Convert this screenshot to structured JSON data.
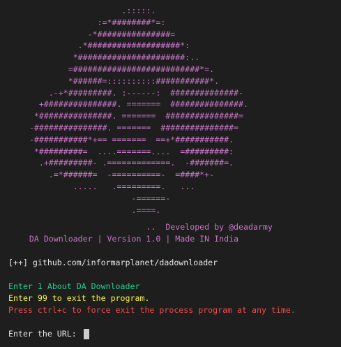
{
  "terminal": {
    "ascii_art_lines": [
      "                         .:::::.",
      "                    :=*########*=:",
      "                  -*###############=",
      "                .*###################*:",
      "               *######################:..",
      "              =##########################*=.",
      "              *######=::::::::::###########*.",
      "          .-+*#########. :------:  ##############-",
      "        +###############. =======  ###############.",
      "       *###############. =======  ###############=",
      "      -###############. =======  ###############=",
      "      -###########*+== =======  ==+*###########.",
      "       *#########=  ....=======....  =#########:",
      "        .+#########- .=============.  -#######=.",
      "          .=*######=  -==========-  =####*+-",
      "               .....   .=========.   ...",
      "                           -======-",
      "                           .====."
    ],
    "credit_text": "                              ..  Developed by @deadarmy",
    "version_text": "      DA Downloader | Version 1.0 | Made IN India",
    "repo_text": "[++] github.com/informarplanet/dadownloader",
    "menu_about": "Enter 1 About DA Downloader",
    "menu_exit": "Enter 99 to exit the program.",
    "warning_text": "Press ctrl+c to force exit the process program at any time.",
    "prompt_text": "Enter the URL: ",
    "colors": {
      "background": "#1e1e1e",
      "art_magenta": "#c776c7",
      "text_default": "#e6e6e6",
      "menu_green": "#23d18b",
      "menu_yellow": "#f5f543",
      "warning_red": "#f14c4c",
      "cursor": "#cccccc"
    }
  }
}
